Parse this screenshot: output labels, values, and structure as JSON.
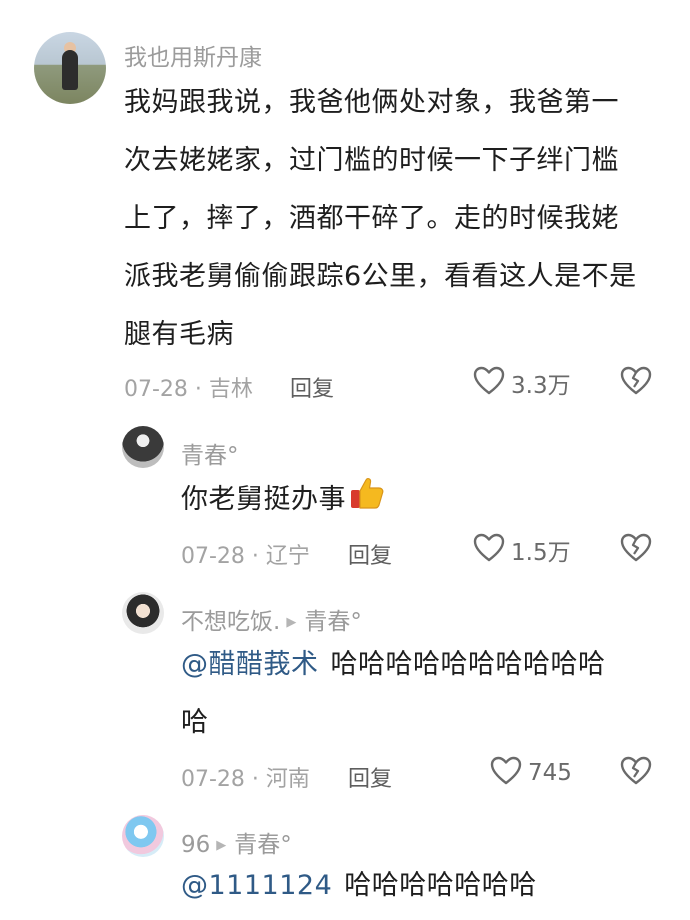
{
  "comments": [
    {
      "username": "我也用斯丹康",
      "lines": [
        "我妈跟我说，我爸他俩处对象，我爸第一",
        "次去姥姥家，过门槛的时候一下子绊门槛",
        "上了，摔了，酒都干碎了。走的时候我姥",
        "派我老舅偷偷跟踪6公里，看看这人是不是",
        "腿有毛病"
      ],
      "date": "07-28",
      "location": "吉林",
      "reply_label": "回复",
      "likes": "3.3万"
    },
    {
      "username": "青春°",
      "text": "你老舅挺办事",
      "emoji": "thumbs-up",
      "date": "07-28",
      "location": "辽宁",
      "reply_label": "回复",
      "likes": "1.5万"
    },
    {
      "username": "不想吃饭.",
      "reply_to": "青春°",
      "mention": "@醋醋莪术",
      "line1": "哈哈哈哈哈哈哈哈哈哈",
      "line2": "哈",
      "date": "07-28",
      "location": "河南",
      "reply_label": "回复",
      "likes": "745"
    },
    {
      "username": "96",
      "reply_to": "青春°",
      "mention": "@1111124",
      "text": "哈哈哈哈哈哈哈"
    }
  ],
  "separator": " · ",
  "icons": {
    "like": "heart-outline-icon",
    "dislike": "broken-heart-icon",
    "reply_arrow": "play-triangle-icon"
  },
  "colors": {
    "mention": "#2f5a86",
    "meta": "#a3a3a3",
    "name": "#9b9b9b"
  }
}
